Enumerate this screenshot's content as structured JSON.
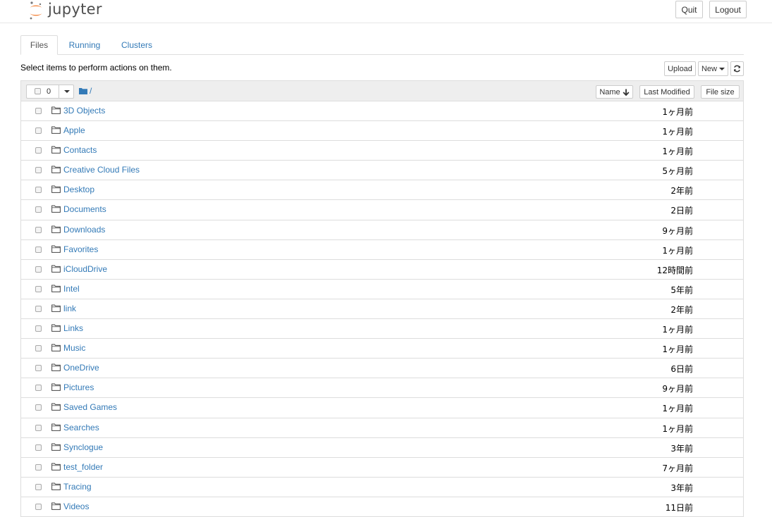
{
  "header": {
    "logo_text": "jupyter",
    "quit_label": "Quit",
    "logout_label": "Logout"
  },
  "tabs": [
    {
      "label": "Files",
      "active": true
    },
    {
      "label": "Running",
      "active": false
    },
    {
      "label": "Clusters",
      "active": false
    }
  ],
  "toolbar": {
    "hint": "Select items to perform actions on them.",
    "upload_label": "Upload",
    "new_label": "New",
    "refresh_icon": "refresh-icon"
  },
  "list_header": {
    "selected_count": "0",
    "breadcrumb": "/",
    "sort_name": "Name",
    "sort_modified": "Last Modified",
    "sort_size": "File size"
  },
  "files": [
    {
      "name": "3D Objects",
      "modified": "1ヶ月前"
    },
    {
      "name": "Apple",
      "modified": "1ヶ月前"
    },
    {
      "name": "Contacts",
      "modified": "1ヶ月前"
    },
    {
      "name": "Creative Cloud Files",
      "modified": "5ヶ月前"
    },
    {
      "name": "Desktop",
      "modified": "2年前"
    },
    {
      "name": "Documents",
      "modified": "2日前"
    },
    {
      "name": "Downloads",
      "modified": "9ヶ月前"
    },
    {
      "name": "Favorites",
      "modified": "1ヶ月前"
    },
    {
      "name": "iCloudDrive",
      "modified": "12時間前"
    },
    {
      "name": "Intel",
      "modified": "5年前"
    },
    {
      "name": "link",
      "modified": "2年前"
    },
    {
      "name": "Links",
      "modified": "1ヶ月前"
    },
    {
      "name": "Music",
      "modified": "1ヶ月前"
    },
    {
      "name": "OneDrive",
      "modified": "6日前"
    },
    {
      "name": "Pictures",
      "modified": "9ヶ月前"
    },
    {
      "name": "Saved Games",
      "modified": "1ヶ月前"
    },
    {
      "name": "Searches",
      "modified": "1ヶ月前"
    },
    {
      "name": "Synclogue",
      "modified": "3年前"
    },
    {
      "name": "test_folder",
      "modified": "7ヶ月前"
    },
    {
      "name": "Tracing",
      "modified": "3年前"
    },
    {
      "name": "Videos",
      "modified": "11日前"
    }
  ],
  "colors": {
    "link": "#337ab7",
    "logo_orange": "#f37726",
    "logo_gray": "#767677"
  }
}
